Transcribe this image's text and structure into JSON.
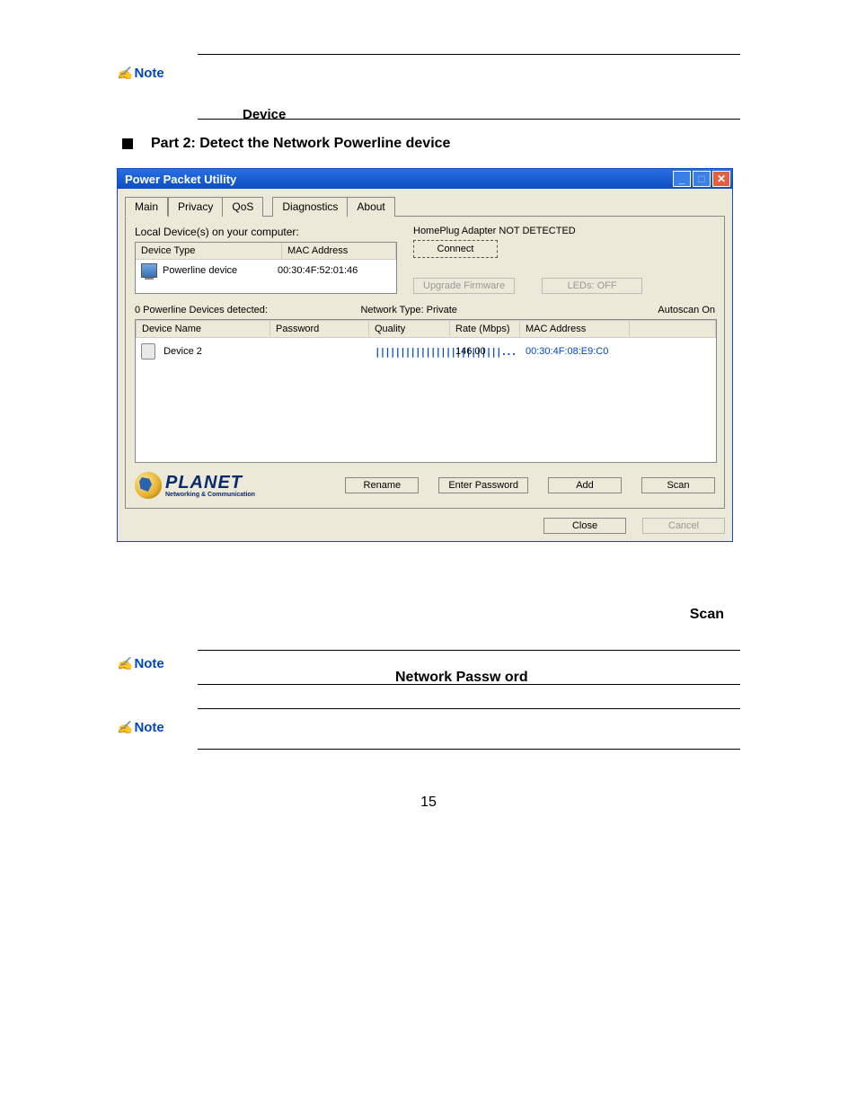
{
  "notes": {
    "label": "Note",
    "device_word": "Device",
    "network_password": "Network Passw  ord"
  },
  "bullet": {
    "text": "Part 2: Detect the Network Powerline device"
  },
  "window": {
    "title": "Power Packet Utility",
    "tabs": [
      "Main",
      "Privacy",
      "QoS",
      "Diagnostics",
      "About"
    ],
    "local_label": "Local Device(s) on your computer:",
    "local_headers": {
      "type": "Device Type",
      "mac": "MAC Address"
    },
    "local_row": {
      "type": "Powerline device",
      "mac": "00:30:4F:52:01:46"
    },
    "adapter_status": "HomePlug Adapter NOT DETECTED",
    "connect_btn": "Connect",
    "upgrade_btn": "Upgrade Firmware",
    "leds_btn": "LEDs:   OFF",
    "detected_text": "0 Powerline Devices detected:",
    "network_type": "Network Type: Private",
    "autoscan": "Autoscan On",
    "dev_headers": {
      "name": "Device Name",
      "password": "Password",
      "quality": "Quality",
      "rate": "Rate (Mbps)",
      "mac": "MAC Address"
    },
    "dev_row": {
      "name": "Device 2",
      "password": "",
      "quality": "|||||||||||||||||||||||||...",
      "rate": "146.00",
      "mac": "00:30:4F:08:E9:C0"
    },
    "logo": {
      "name": "PLANET",
      "tagline": "Networking & Communication"
    },
    "buttons": {
      "rename": "Rename",
      "enter_pw": "Enter Password",
      "add": "Add",
      "scan": "Scan"
    },
    "footer": {
      "close": "Close",
      "cancel": "Cancel"
    }
  },
  "scan_word": "Scan",
  "page_number": "15"
}
